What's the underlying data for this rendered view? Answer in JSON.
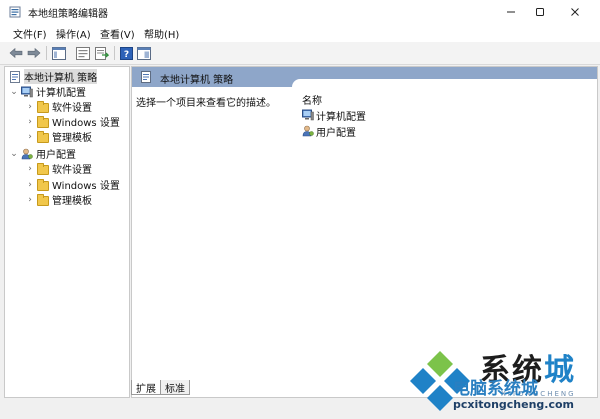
{
  "window": {
    "title": "本地组策略编辑器",
    "controls": {
      "minimize": "—",
      "maximize": "☐",
      "close": "✕"
    }
  },
  "menu": [
    {
      "label": "文件(F)"
    },
    {
      "label": "操作(A)"
    },
    {
      "label": "查看(V)"
    },
    {
      "label": "帮助(H)"
    }
  ],
  "toolbar": {
    "buttons": [
      "back-arrow-icon",
      "forward-arrow-icon",
      "show-hide-tree-icon",
      "properties-icon",
      "export-list-icon",
      "help-icon",
      "extended-view-icon"
    ]
  },
  "tree": {
    "root": "本地计算机 策略",
    "computer_config": "计算机配置",
    "user_config": "用户配置",
    "software_settings": "软件设置",
    "windows_settings": "Windows 设置",
    "admin_templates": "管理模板"
  },
  "right_pane": {
    "header": "本地计算机 策略",
    "description": "选择一个项目来查看它的描述。",
    "column_name": "名称",
    "items": [
      "计算机配置",
      "用户配置"
    ]
  },
  "tabs": [
    "扩展",
    "标准"
  ],
  "watermark": {
    "line1_a": "系统",
    "line1_b": "城",
    "line2": "电脑系统城",
    "line3": "pcxitongcheng.com",
    "faint": "XITONGCHENG"
  },
  "colors": {
    "header_band": "#8ea6c9",
    "accent_blue": "#1f82c7",
    "folder_yellow": "#f1c74b"
  }
}
